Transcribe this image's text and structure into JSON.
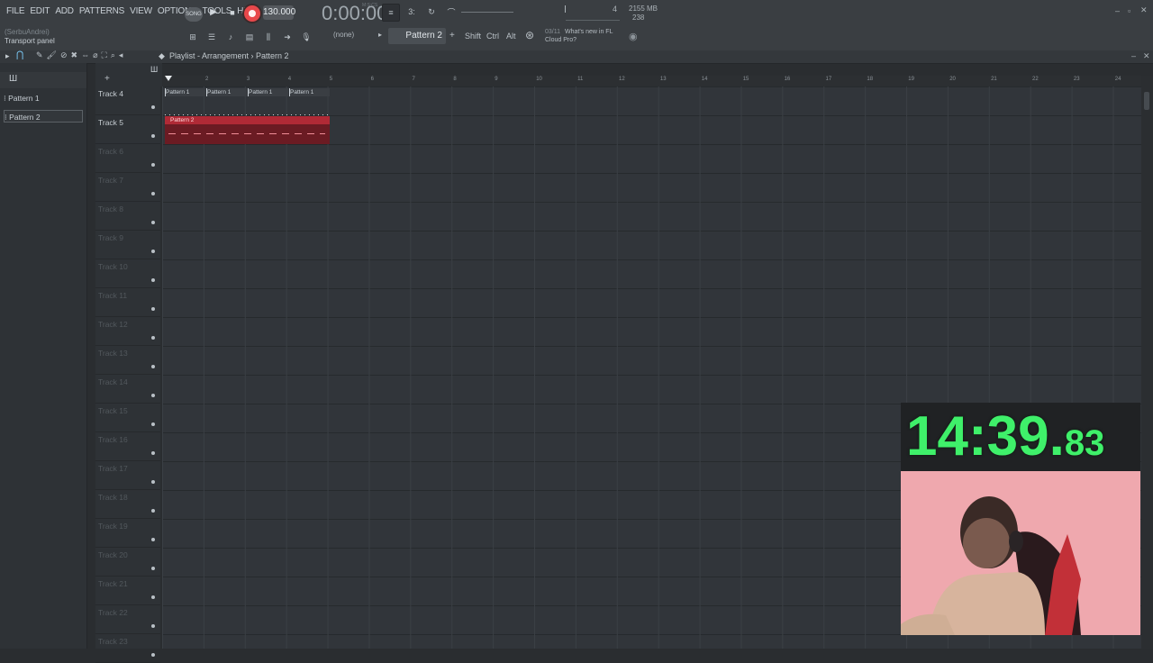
{
  "menu": [
    "FILE",
    "EDIT",
    "ADD",
    "PATTERNS",
    "VIEW",
    "OPTIONS",
    "TOOLS",
    "HELP"
  ],
  "hint": {
    "user": "(SerbuAndrei)",
    "panel": "Transport panel"
  },
  "transport": {
    "mode": "SONG",
    "tempo": "130.000",
    "time": "0:00:00",
    "time_label": "M:S:CS"
  },
  "system": {
    "memory": "2155 MB",
    "polyphony": "238",
    "cpu_val": "4"
  },
  "toolbar": {
    "none_label": "(none)",
    "pattern_selected": "Pattern 2",
    "plus": "+",
    "keys": [
      "Shift",
      "Ctrl",
      "Alt"
    ]
  },
  "news": {
    "count": "03/11",
    "title": "What's new in FL",
    "title2": "Cloud Pro?"
  },
  "playlist": {
    "breadcrumb": "Playlist - Arrangement › Pattern 2"
  },
  "picker": {
    "items": [
      "Pattern 1",
      "Pattern 2"
    ]
  },
  "tracks": [
    "Track 4",
    "Track 5",
    "Track 6",
    "Track 7",
    "Track 8",
    "Track 9",
    "Track 10",
    "Track 11",
    "Track 12",
    "Track 13",
    "Track 14",
    "Track 15",
    "Track 16",
    "Track 17",
    "Track 18",
    "Track 19",
    "Track 20",
    "Track 21",
    "Track 22",
    "Track 23"
  ],
  "ruler": [
    "2",
    "3",
    "4",
    "5",
    "6",
    "7",
    "8",
    "9",
    "10",
    "11",
    "12",
    "13",
    "14",
    "15",
    "16",
    "17",
    "18",
    "19",
    "20",
    "21",
    "22",
    "23",
    "24"
  ],
  "clips": {
    "track4": [
      "Pattern 1",
      "Pattern 1",
      "Pattern 1",
      "Pattern 1"
    ],
    "track5": "Pattern 2"
  },
  "overlay": {
    "timer_main": "14:39.",
    "timer_cs": "83"
  },
  "colors": {
    "record": "#e8484b",
    "clip_pattern2": "#b02a36",
    "timer": "#3ff06a"
  }
}
